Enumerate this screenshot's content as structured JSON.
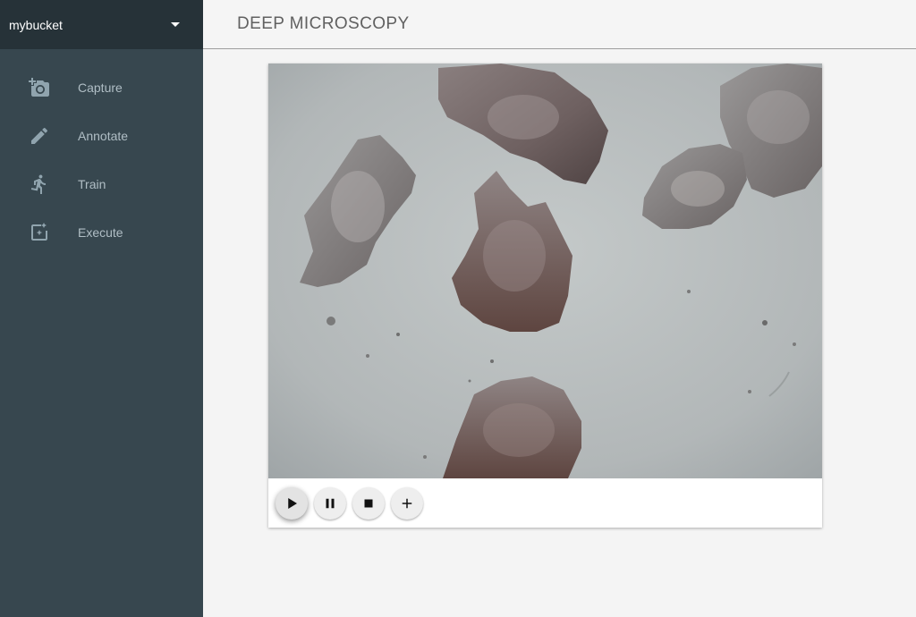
{
  "sidebar": {
    "bucket": {
      "name": "mybucket"
    },
    "items": [
      {
        "label": "Capture",
        "icon": "add-camera-icon"
      },
      {
        "label": "Annotate",
        "icon": "pencil-icon"
      },
      {
        "label": "Train",
        "icon": "running-person-icon"
      },
      {
        "label": "Execute",
        "icon": "execute-icon"
      }
    ]
  },
  "header": {
    "title": "DEEP MICROSCOPY"
  },
  "viewer": {
    "controls": [
      {
        "icon": "play-icon"
      },
      {
        "icon": "pause-icon"
      },
      {
        "icon": "stop-icon"
      },
      {
        "icon": "plus-icon"
      }
    ]
  },
  "colors": {
    "sidebar": "#37474f",
    "sidebar_header": "#263238",
    "nav_text": "#b0bec5",
    "background": "#f4f4f4"
  }
}
